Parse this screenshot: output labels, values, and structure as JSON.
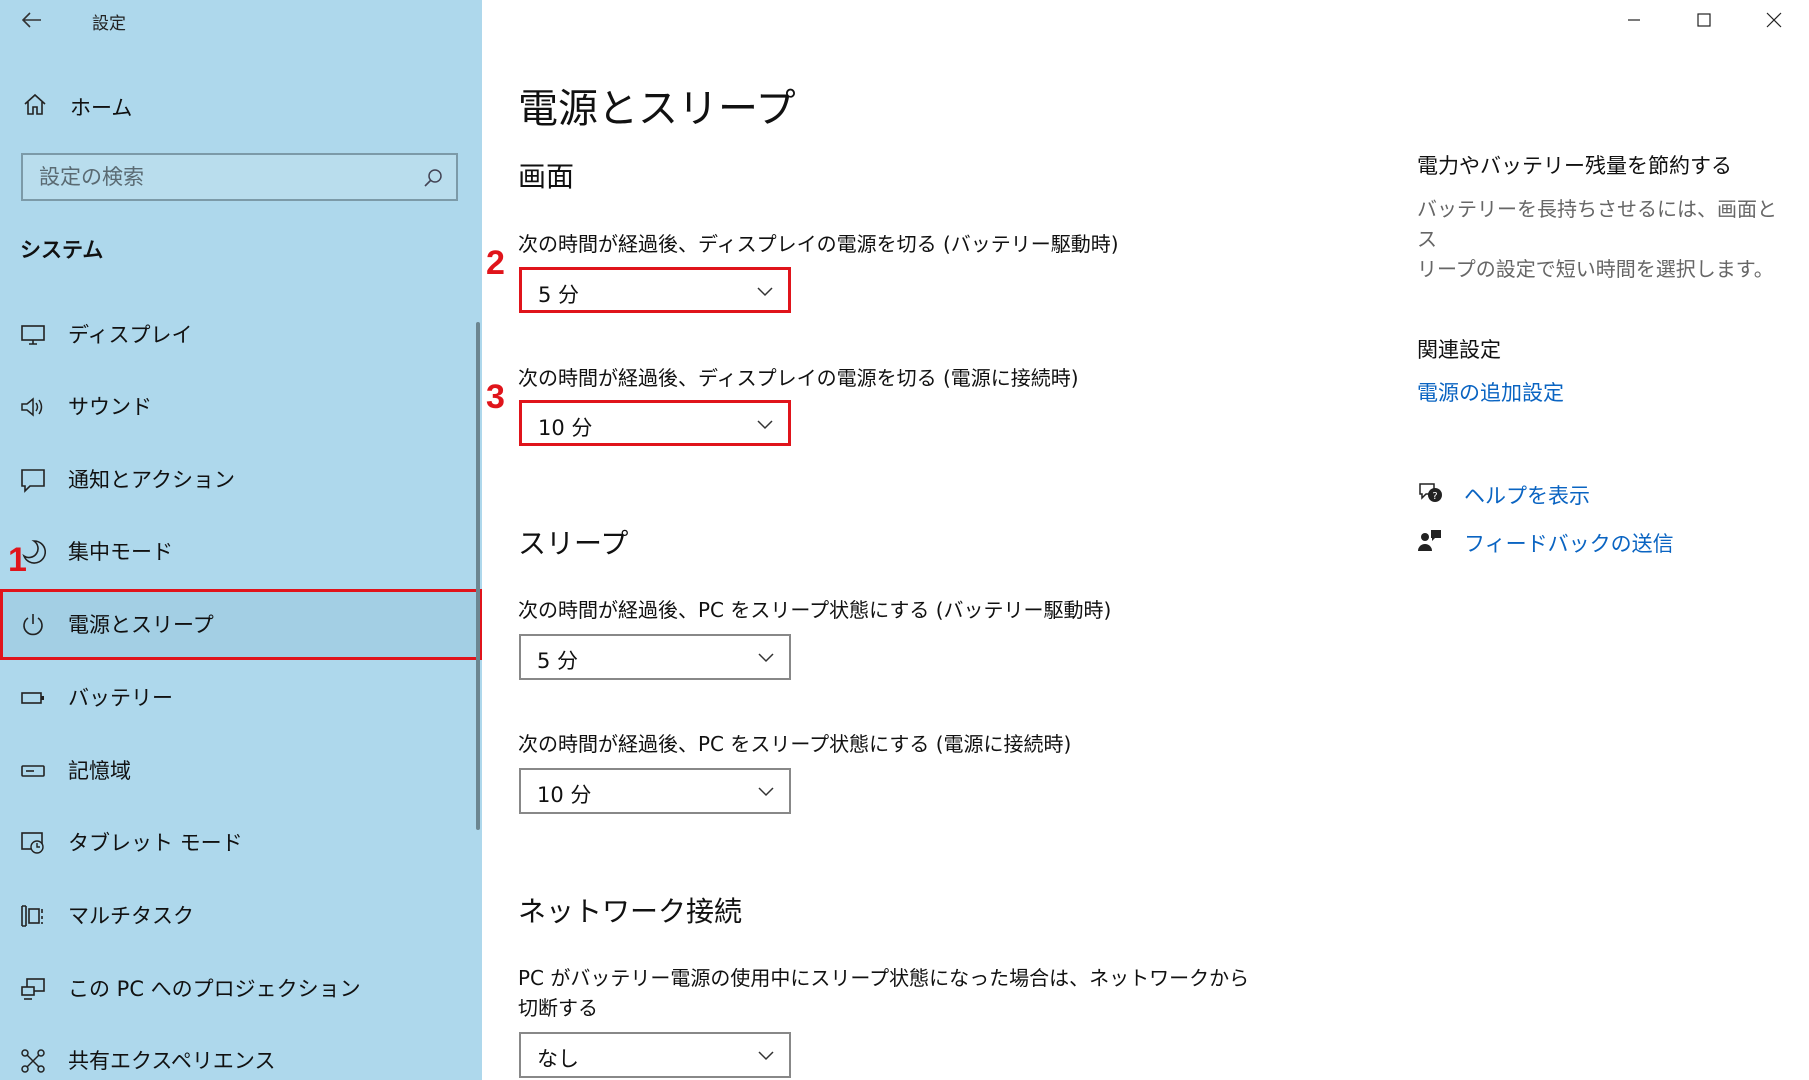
{
  "window": {
    "title": "設定",
    "controls": [
      "minimize-icon",
      "maximize-icon",
      "close-icon"
    ]
  },
  "sidebar": {
    "home_label": "ホーム",
    "search_placeholder": "設定の検索",
    "section_heading": "システム",
    "items": [
      {
        "label": "ディスプレイ",
        "icon": "display-icon"
      },
      {
        "label": "サウンド",
        "icon": "speaker-icon"
      },
      {
        "label": "通知とアクション",
        "icon": "notification-icon"
      },
      {
        "label": "集中モード",
        "icon": "focus-moon-icon"
      },
      {
        "label": "電源とスリープ",
        "icon": "power-icon",
        "selected": true
      },
      {
        "label": "バッテリー",
        "icon": "battery-icon"
      },
      {
        "label": "記憶域",
        "icon": "storage-icon"
      },
      {
        "label": "タブレット モード",
        "icon": "tablet-icon"
      },
      {
        "label": "マルチタスク",
        "icon": "multitask-icon"
      },
      {
        "label": "この PC へのプロジェクション",
        "icon": "projection-icon"
      },
      {
        "label": "共有エクスペリエンス",
        "icon": "shared-experience-icon"
      }
    ]
  },
  "main": {
    "title": "電源とスリープ",
    "screen": {
      "heading": "画面",
      "battery_label": "次の時間が経過後、ディスプレイの電源を切る (バッテリー駆動時)",
      "battery_value": "5 分",
      "plugged_label": "次の時間が経過後、ディスプレイの電源を切る (電源に接続時)",
      "plugged_value": "10 分"
    },
    "sleep": {
      "heading": "スリープ",
      "battery_label": "次の時間が経過後、PC をスリープ状態にする (バッテリー駆動時)",
      "battery_value": "5 分",
      "plugged_label": "次の時間が経過後、PC をスリープ状態にする (電源に接続時)",
      "plugged_value": "10 分"
    },
    "network": {
      "heading": "ネットワーク接続",
      "label_line1": "PC がバッテリー電源の使用中にスリープ状態になった場合は、ネットワークから",
      "label_line2": "切断する",
      "value": "なし"
    }
  },
  "annotations": {
    "marker1": "1",
    "marker2": "2",
    "marker3": "3",
    "highlight_color": "#e0141b"
  },
  "aside": {
    "save_title": "電力やバッテリー残量を節約する",
    "save_desc_line1": "バッテリーを長持ちさせるには、画面とス",
    "save_desc_line2": "リープの設定で短い時間を選択します。",
    "related_title": "関連設定",
    "related_link": "電源の追加設定",
    "help_link": "ヘルプを表示",
    "feedback_link": "フィードバックの送信"
  },
  "colors": {
    "sidebar_bg": "#aed8ec",
    "accent_link": "#0a64c2"
  }
}
